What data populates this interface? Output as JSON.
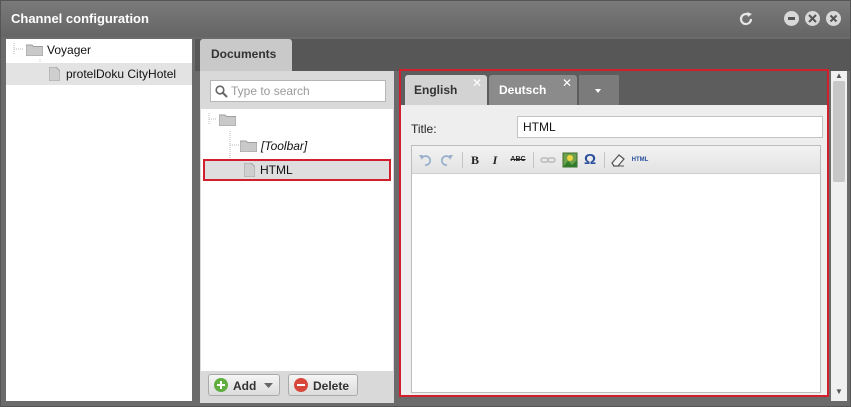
{
  "window": {
    "title": "Channel configuration"
  },
  "tree": {
    "root": "Voyager",
    "child": "protelDoku CityHotel"
  },
  "documents": {
    "tab_label": "Documents",
    "search_placeholder": "Type to search",
    "items": [
      "[Toolbar]",
      "HTML"
    ],
    "add_label": "Add",
    "delete_label": "Delete"
  },
  "editor": {
    "lang_tabs": [
      "English",
      "Deutsch"
    ],
    "title_label": "Title:",
    "title_value": "HTML",
    "toolbar": {
      "bold": "B",
      "italic": "I",
      "strike": "ABC",
      "special_char": "Ω",
      "html": "HTML"
    }
  },
  "colors": {
    "highlight": "#d11f2d",
    "chrome": "#6b6b6b"
  }
}
